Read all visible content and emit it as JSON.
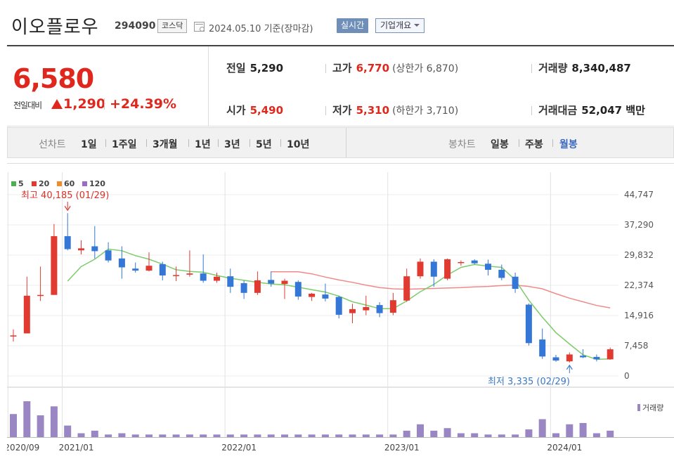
{
  "header": {
    "company_name": "이오플로우",
    "code": "294090",
    "market": "코스닥",
    "date_text": "2024.05.10  기준(장마감)",
    "realtime_label": "실시간",
    "company_info_label": "기업개요"
  },
  "quote": {
    "price": "6,580",
    "change_label": "전일대비",
    "change_value": "1,290",
    "change_pct": "+24.39%",
    "prev_label": "전일",
    "prev_value": "5,290",
    "high_label": "고가",
    "high_value": "6,770",
    "upper_limit": "(상한가 6,870)",
    "volume_label": "거래량",
    "volume_value": "8,340,487",
    "open_label": "시가",
    "open_value": "5,490",
    "low_label": "저가",
    "low_value": "5,310",
    "lower_limit": "(하한가 3,710)",
    "amount_label": "거래대금",
    "amount_value": "52,047 백만"
  },
  "periods": {
    "line_label": "선차트",
    "line_items": [
      "1일",
      "1주일",
      "3개월",
      "1년",
      "3년",
      "5년",
      "10년"
    ],
    "candle_label": "봉차트",
    "candle_items": [
      "일봉",
      "주봉",
      "월봉"
    ],
    "selected": "월봉"
  },
  "colors": {
    "up": "#e03a31",
    "down": "#3477d6",
    "ma5": "#7ccc6b",
    "ma20": "#f08a8a",
    "volume": "#9b86c4",
    "accent": "#e0271d"
  },
  "chart_data": {
    "type": "candlestick",
    "legend": [
      {
        "name": "5",
        "color": "#4cb050"
      },
      {
        "name": "20",
        "color": "#e03a31"
      },
      {
        "name": "60",
        "color": "#f08c2a"
      },
      {
        "name": "120",
        "color": "#9b6cc4"
      }
    ],
    "y_ticks": [
      "44,747",
      "37,290",
      "29,832",
      "22,374",
      "14,916",
      "7,458",
      "0"
    ],
    "y_tick_values": [
      44747,
      37290,
      29832,
      22374,
      14916,
      7458,
      0
    ],
    "ylim": [
      0,
      44747
    ],
    "x_ticks": [
      {
        "label": "2020/09",
        "index": 0
      },
      {
        "label": "2021/01",
        "index": 4
      },
      {
        "label": "2022/01",
        "index": 16
      },
      {
        "label": "2023/01",
        "index": 28
      },
      {
        "label": "2024/01",
        "index": 40
      }
    ],
    "annotation_high": "최고 40,185 (01/29)",
    "annotation_high_index": 4,
    "annotation_high_value": 40185,
    "annotation_low": "최저 3,335 (02/29)",
    "annotation_low_index": 41,
    "annotation_low_value": 3335,
    "volume_label": "거래량",
    "candles": [
      {
        "o": 10000,
        "h": 11500,
        "l": 8500,
        "c": 10000
      },
      {
        "o": 10500,
        "h": 24500,
        "l": 10500,
        "c": 19800
      },
      {
        "o": 19800,
        "h": 27000,
        "l": 18500,
        "c": 20000
      },
      {
        "o": 20000,
        "h": 37500,
        "l": 20000,
        "c": 34500
      },
      {
        "o": 34500,
        "h": 40185,
        "l": 31000,
        "c": 31300
      },
      {
        "o": 31000,
        "h": 33500,
        "l": 30000,
        "c": 31500
      },
      {
        "o": 32000,
        "h": 37000,
        "l": 29000,
        "c": 30800
      },
      {
        "o": 31000,
        "h": 33000,
        "l": 28000,
        "c": 28500
      },
      {
        "o": 29000,
        "h": 32000,
        "l": 24000,
        "c": 26800
      },
      {
        "o": 26500,
        "h": 28000,
        "l": 25500,
        "c": 26000
      },
      {
        "o": 26000,
        "h": 30500,
        "l": 25800,
        "c": 27200
      },
      {
        "o": 27600,
        "h": 28200,
        "l": 23600,
        "c": 24800
      },
      {
        "o": 24800,
        "h": 27000,
        "l": 23400,
        "c": 24900
      },
      {
        "o": 25000,
        "h": 31000,
        "l": 24500,
        "c": 25300
      },
      {
        "o": 25300,
        "h": 30000,
        "l": 23000,
        "c": 23500
      },
      {
        "o": 23500,
        "h": 25500,
        "l": 23000,
        "c": 24500
      },
      {
        "o": 24600,
        "h": 26500,
        "l": 20500,
        "c": 22000
      },
      {
        "o": 22900,
        "h": 23500,
        "l": 19000,
        "c": 20500
      },
      {
        "o": 20500,
        "h": 25800,
        "l": 20000,
        "c": 23600
      },
      {
        "o": 23700,
        "h": 25800,
        "l": 22000,
        "c": 22800
      },
      {
        "o": 22700,
        "h": 24000,
        "l": 19000,
        "c": 23500
      },
      {
        "o": 23200,
        "h": 23600,
        "l": 18800,
        "c": 19600
      },
      {
        "o": 19500,
        "h": 20500,
        "l": 18500,
        "c": 20300
      },
      {
        "o": 20100,
        "h": 22800,
        "l": 18400,
        "c": 19100
      },
      {
        "o": 19500,
        "h": 19800,
        "l": 14200,
        "c": 15100
      },
      {
        "o": 15500,
        "h": 17800,
        "l": 13000,
        "c": 16500
      },
      {
        "o": 16200,
        "h": 19800,
        "l": 15000,
        "c": 17000
      },
      {
        "o": 17500,
        "h": 18200,
        "l": 14500,
        "c": 15500
      },
      {
        "o": 15600,
        "h": 20500,
        "l": 15000,
        "c": 18700
      },
      {
        "o": 18600,
        "h": 26500,
        "l": 18300,
        "c": 24600
      },
      {
        "o": 24600,
        "h": 29000,
        "l": 24000,
        "c": 28200
      },
      {
        "o": 28200,
        "h": 28800,
        "l": 22000,
        "c": 24500
      },
      {
        "o": 24000,
        "h": 29000,
        "l": 23600,
        "c": 28800
      },
      {
        "o": 28000,
        "h": 28500,
        "l": 27200,
        "c": 28100
      },
      {
        "o": 28500,
        "h": 28800,
        "l": 27500,
        "c": 27800
      },
      {
        "o": 27700,
        "h": 28700,
        "l": 24800,
        "c": 26200
      },
      {
        "o": 26200,
        "h": 27500,
        "l": 23600,
        "c": 24200
      },
      {
        "o": 24500,
        "h": 25500,
        "l": 20500,
        "c": 21500
      },
      {
        "o": 17600,
        "h": 17900,
        "l": 7500,
        "c": 8100
      },
      {
        "o": 9000,
        "h": 11700,
        "l": 4200,
        "c": 4800
      },
      {
        "o": 4600,
        "h": 5200,
        "l": 3500,
        "c": 3800
      },
      {
        "o": 3600,
        "h": 5800,
        "l": 3335,
        "c": 5300
      },
      {
        "o": 5000,
        "h": 6600,
        "l": 4400,
        "c": 4600
      },
      {
        "o": 4700,
        "h": 5300,
        "l": 3600,
        "c": 4100
      },
      {
        "o": 4100,
        "h": 7000,
        "l": 4000,
        "c": 6580
      }
    ],
    "ma5": [
      null,
      null,
      null,
      null,
      23400,
      27000,
      28800,
      31300,
      30900,
      29700,
      28800,
      27600,
      26200,
      25800,
      25600,
      24800,
      24100,
      23600,
      23100,
      22700,
      22500,
      21900,
      21300,
      20700,
      19700,
      18300,
      17500,
      16600,
      16600,
      18500,
      20800,
      22600,
      24900,
      26800,
      27500,
      27100,
      26800,
      23700,
      18700,
      14500,
      10700,
      7900,
      5200,
      4100,
      4200
    ],
    "ma20": [
      null,
      null,
      null,
      null,
      null,
      null,
      null,
      null,
      null,
      null,
      null,
      null,
      null,
      null,
      null,
      null,
      null,
      null,
      null,
      25700,
      25700,
      25700,
      25200,
      24400,
      23700,
      23100,
      22400,
      21800,
      21500,
      21400,
      21500,
      21600,
      21700,
      21800,
      22000,
      22100,
      22300,
      22400,
      22100,
      21500,
      20300,
      19200,
      18300,
      17400,
      16800
    ],
    "volume": [
      18,
      28,
      17,
      24,
      9,
      3,
      5,
      2,
      3,
      2,
      2,
      2,
      2,
      2,
      2,
      2,
      2,
      2,
      2,
      2,
      2,
      2,
      2,
      2,
      2,
      2,
      2,
      2,
      2,
      5,
      10,
      5,
      7,
      3,
      3,
      2,
      2,
      2,
      6,
      14,
      3,
      10,
      11,
      3,
      5
    ]
  }
}
